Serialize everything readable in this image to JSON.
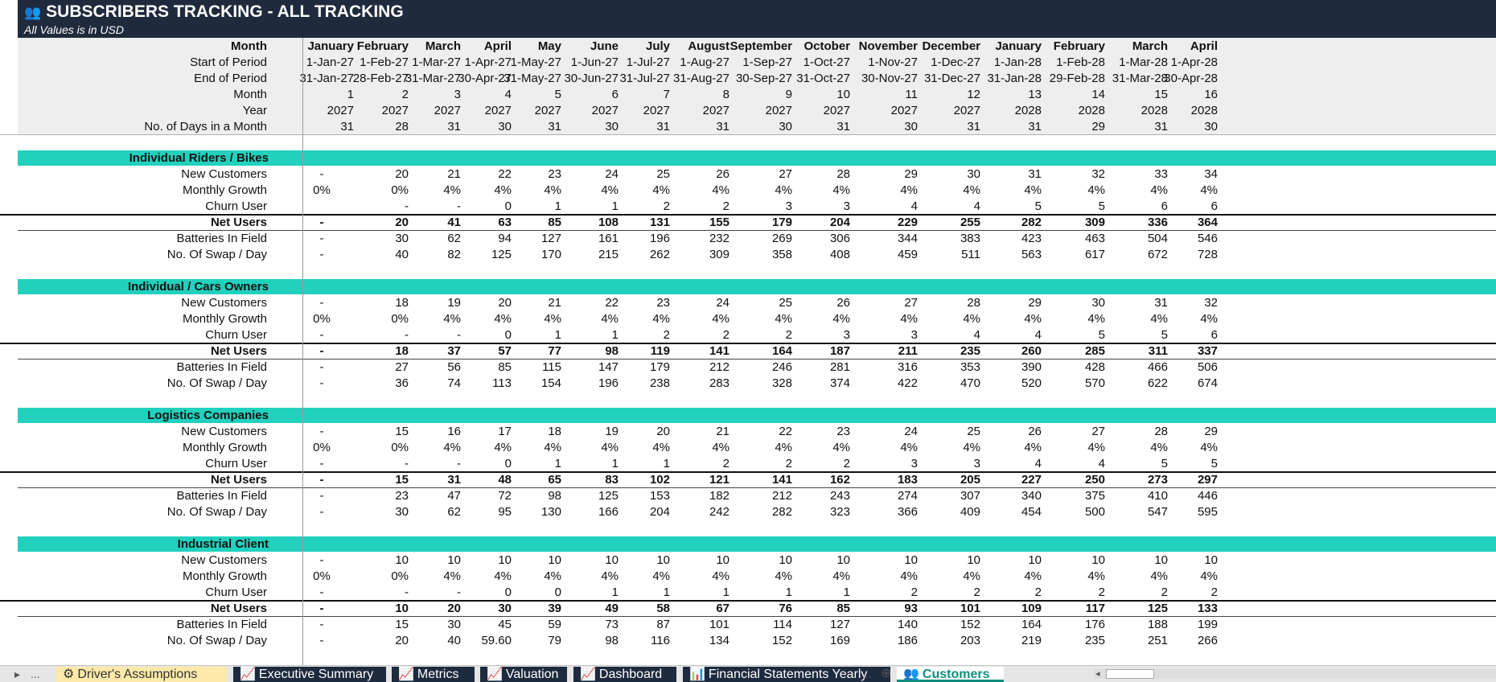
{
  "title": {
    "icon": "users-icon",
    "text": "SUBSCRIBERS TRACKING - ALL TRACKING",
    "subtitle": "All Values is in USD"
  },
  "header_rows": [
    {
      "label": "Month",
      "values": [
        "January",
        "February",
        "March",
        "April",
        "May",
        "June",
        "July",
        "August",
        "September",
        "October",
        "November",
        "December",
        "January",
        "February",
        "March",
        "April"
      ],
      "bold": true
    },
    {
      "label": "Start of Period",
      "values": [
        "1-Jan-27",
        "1-Feb-27",
        "1-Mar-27",
        "1-Apr-27",
        "1-May-27",
        "1-Jun-27",
        "1-Jul-27",
        "1-Aug-27",
        "1-Sep-27",
        "1-Oct-27",
        "1-Nov-27",
        "1-Dec-27",
        "1-Jan-28",
        "1-Feb-28",
        "1-Mar-28",
        "1-Apr-28"
      ]
    },
    {
      "label": "End of Period",
      "values": [
        "31-Jan-27",
        "28-Feb-27",
        "31-Mar-27",
        "30-Apr-27",
        "31-May-27",
        "30-Jun-27",
        "31-Jul-27",
        "31-Aug-27",
        "30-Sep-27",
        "31-Oct-27",
        "30-Nov-27",
        "31-Dec-27",
        "31-Jan-28",
        "29-Feb-28",
        "31-Mar-28",
        "30-Apr-28"
      ]
    },
    {
      "label": "Month",
      "values": [
        "1",
        "2",
        "3",
        "4",
        "5",
        "6",
        "7",
        "8",
        "9",
        "10",
        "11",
        "12",
        "13",
        "14",
        "15",
        "16"
      ]
    },
    {
      "label": "Year",
      "values": [
        "2027",
        "2027",
        "2027",
        "2027",
        "2027",
        "2027",
        "2027",
        "2027",
        "2027",
        "2027",
        "2027",
        "2027",
        "2028",
        "2028",
        "2028",
        "2028"
      ]
    },
    {
      "label": "No. of Days in a Month",
      "values": [
        "31",
        "28",
        "31",
        "30",
        "31",
        "30",
        "31",
        "31",
        "30",
        "31",
        "30",
        "31",
        "31",
        "29",
        "31",
        "30"
      ]
    }
  ],
  "sections": [
    {
      "title": "Individual Riders / Bikes",
      "rows": [
        {
          "label": "New Customers",
          "values": [
            "-",
            "20",
            "21",
            "22",
            "23",
            "24",
            "25",
            "26",
            "27",
            "28",
            "29",
            "30",
            "31",
            "32",
            "33",
            "34"
          ]
        },
        {
          "label": "Monthly Growth",
          "values": [
            "0%",
            "0%",
            "4%",
            "4%",
            "4%",
            "4%",
            "4%",
            "4%",
            "4%",
            "4%",
            "4%",
            "4%",
            "4%",
            "4%",
            "4%",
            "4%"
          ]
        },
        {
          "label": "Churn User",
          "values": [
            "",
            "-",
            "-",
            "0",
            "1",
            "1",
            "2",
            "2",
            "3",
            "3",
            "4",
            "4",
            "5",
            "5",
            "6",
            "6"
          ]
        },
        {
          "label": "Net Users",
          "bold": true,
          "values": [
            "-",
            "20",
            "41",
            "63",
            "85",
            "108",
            "131",
            "155",
            "179",
            "204",
            "229",
            "255",
            "282",
            "309",
            "336",
            "364"
          ]
        },
        {
          "label": "Batteries In Field",
          "values": [
            "-",
            "30",
            "62",
            "94",
            "127",
            "161",
            "196",
            "232",
            "269",
            "306",
            "344",
            "383",
            "423",
            "463",
            "504",
            "546"
          ]
        },
        {
          "label": "No. Of Swap / Day",
          "values": [
            "-",
            "40",
            "82",
            "125",
            "170",
            "215",
            "262",
            "309",
            "358",
            "408",
            "459",
            "511",
            "563",
            "617",
            "672",
            "728"
          ]
        }
      ]
    },
    {
      "title": "Individual / Cars Owners",
      "rows": [
        {
          "label": "New Customers",
          "values": [
            "-",
            "18",
            "19",
            "20",
            "21",
            "22",
            "23",
            "24",
            "25",
            "26",
            "27",
            "28",
            "29",
            "30",
            "31",
            "32"
          ]
        },
        {
          "label": "Monthly Growth",
          "values": [
            "0%",
            "0%",
            "4%",
            "4%",
            "4%",
            "4%",
            "4%",
            "4%",
            "4%",
            "4%",
            "4%",
            "4%",
            "4%",
            "4%",
            "4%",
            "4%"
          ]
        },
        {
          "label": "Churn User",
          "values": [
            "-",
            "-",
            "-",
            "0",
            "1",
            "1",
            "2",
            "2",
            "2",
            "3",
            "3",
            "4",
            "4",
            "5",
            "5",
            "6"
          ]
        },
        {
          "label": "Net Users",
          "bold": true,
          "values": [
            "-",
            "18",
            "37",
            "57",
            "77",
            "98",
            "119",
            "141",
            "164",
            "187",
            "211",
            "235",
            "260",
            "285",
            "311",
            "337"
          ]
        },
        {
          "label": "Batteries In Field",
          "values": [
            "-",
            "27",
            "56",
            "85",
            "115",
            "147",
            "179",
            "212",
            "246",
            "281",
            "316",
            "353",
            "390",
            "428",
            "466",
            "506"
          ]
        },
        {
          "label": "No. Of Swap / Day",
          "values": [
            "-",
            "36",
            "74",
            "113",
            "154",
            "196",
            "238",
            "283",
            "328",
            "374",
            "422",
            "470",
            "520",
            "570",
            "622",
            "674"
          ]
        }
      ]
    },
    {
      "title": "Logistics Companies",
      "rows": [
        {
          "label": "New Customers",
          "values": [
            "-",
            "15",
            "16",
            "17",
            "18",
            "19",
            "20",
            "21",
            "22",
            "23",
            "24",
            "25",
            "26",
            "27",
            "28",
            "29"
          ]
        },
        {
          "label": "Monthly Growth",
          "values": [
            "0%",
            "0%",
            "4%",
            "4%",
            "4%",
            "4%",
            "4%",
            "4%",
            "4%",
            "4%",
            "4%",
            "4%",
            "4%",
            "4%",
            "4%",
            "4%"
          ]
        },
        {
          "label": "Churn User",
          "values": [
            "-",
            "-",
            "-",
            "0",
            "1",
            "1",
            "1",
            "2",
            "2",
            "2",
            "3",
            "3",
            "4",
            "4",
            "5",
            "5"
          ]
        },
        {
          "label": "Net Users",
          "bold": true,
          "values": [
            "-",
            "15",
            "31",
            "48",
            "65",
            "83",
            "102",
            "121",
            "141",
            "162",
            "183",
            "205",
            "227",
            "250",
            "273",
            "297"
          ]
        },
        {
          "label": "Batteries In Field",
          "values": [
            "-",
            "23",
            "47",
            "72",
            "98",
            "125",
            "153",
            "182",
            "212",
            "243",
            "274",
            "307",
            "340",
            "375",
            "410",
            "446"
          ]
        },
        {
          "label": "No. Of Swap / Day",
          "values": [
            "-",
            "30",
            "62",
            "95",
            "130",
            "166",
            "204",
            "242",
            "282",
            "323",
            "366",
            "409",
            "454",
            "500",
            "547",
            "595"
          ]
        }
      ]
    },
    {
      "title": "Industrial Client",
      "rows": [
        {
          "label": "New Customers",
          "values": [
            "-",
            "10",
            "10",
            "10",
            "10",
            "10",
            "10",
            "10",
            "10",
            "10",
            "10",
            "10",
            "10",
            "10",
            "10",
            "10"
          ]
        },
        {
          "label": "Monthly Growth",
          "values": [
            "0%",
            "0%",
            "4%",
            "4%",
            "4%",
            "4%",
            "4%",
            "4%",
            "4%",
            "4%",
            "4%",
            "4%",
            "4%",
            "4%",
            "4%",
            "4%"
          ]
        },
        {
          "label": "Churn User",
          "values": [
            "-",
            "-",
            "-",
            "0",
            "0",
            "1",
            "1",
            "1",
            "1",
            "1",
            "2",
            "2",
            "2",
            "2",
            "2",
            "2"
          ]
        },
        {
          "label": "Net Users",
          "bold": true,
          "values": [
            "-",
            "10",
            "20",
            "30",
            "39",
            "49",
            "58",
            "67",
            "76",
            "85",
            "93",
            "101",
            "109",
            "117",
            "125",
            "133"
          ]
        },
        {
          "label": "Batteries In Field",
          "values": [
            "-",
            "15",
            "30",
            "45",
            "59",
            "73",
            "87",
            "101",
            "114",
            "127",
            "140",
            "152",
            "164",
            "176",
            "188",
            "199"
          ]
        },
        {
          "label": "No. Of Swap / Day",
          "values": [
            "-",
            "20",
            "40",
            "59.60",
            "79",
            "98",
            "116",
            "134",
            "152",
            "169",
            "186",
            "203",
            "219",
            "235",
            "251",
            "266"
          ]
        }
      ]
    }
  ],
  "tabs": [
    {
      "label": "Driver's Assumptions",
      "icon": "gear-icon",
      "glyph": "⚙",
      "style": "first"
    },
    {
      "label": "Executive Summary",
      "icon": "chart-icon",
      "glyph": "📈",
      "style": "dark"
    },
    {
      "label": "Metrics",
      "icon": "chart-icon",
      "glyph": "📈",
      "style": "dark"
    },
    {
      "label": "Valuation",
      "icon": "chart-icon",
      "glyph": "📈",
      "style": "dark"
    },
    {
      "label": "Dashboard",
      "icon": "chart-icon",
      "glyph": "📈",
      "style": "dark"
    },
    {
      "label": "Financial Statements Yearly",
      "icon": "bar-chart-icon",
      "glyph": "📊",
      "style": "dark"
    },
    {
      "label": "Customers",
      "icon": "users-icon",
      "glyph": "👥",
      "style": "active"
    }
  ],
  "tabbar": {
    "ellipsis": "...",
    "add": "⊕"
  },
  "colors": {
    "title_bg": "#1f2a3c",
    "band": "#22d1bd",
    "header_bg": "#eeeeee",
    "active_tab": "#0e8f7e"
  }
}
